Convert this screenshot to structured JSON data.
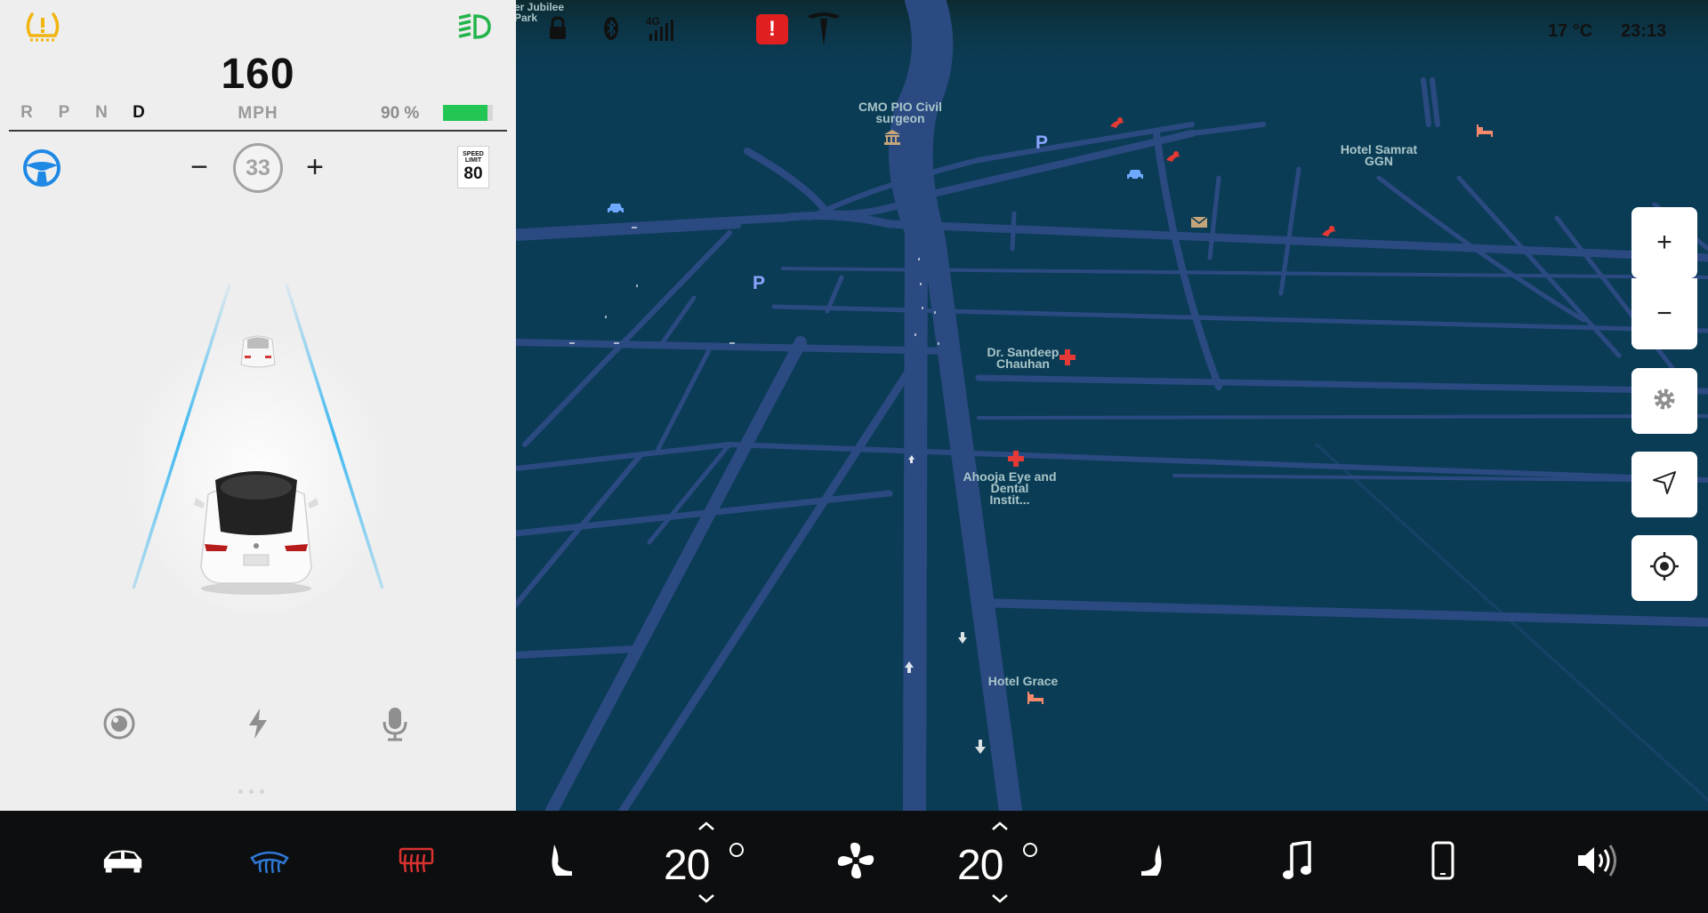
{
  "cluster": {
    "speed": "160",
    "units": "MPH",
    "gears": [
      {
        "label": "R",
        "active": false
      },
      {
        "label": "P",
        "active": false
      },
      {
        "label": "N",
        "active": false
      },
      {
        "label": "D",
        "active": true
      }
    ],
    "battery_label": "90 %",
    "battery_level": 0.9,
    "cruise": {
      "minus": "−",
      "speed": "33",
      "plus": "+"
    },
    "speed_limit": {
      "label_line1": "SPEED",
      "label_line2": "LIMIT",
      "value": "80"
    },
    "icons": {
      "tpms": "tire-pressure-warning-icon",
      "headlights": "headlights-icon",
      "autopilot": "steering-wheel-icon",
      "lead_car": "lead-car-icon",
      "ego_car": "ego-car-icon",
      "shortcut_1": "camera-icon",
      "shortcut_2": "charging-bolt-icon",
      "shortcut_3": "microphone-icon"
    },
    "colors": {
      "tpms": "#f2b40f",
      "headlights": "#22b44b",
      "autopilot": "#1e88e5",
      "battery": "#23c653",
      "lane_lines": "#3eb8f0"
    }
  },
  "map": {
    "status": {
      "temperature": "17 °C",
      "time": "23:13",
      "network": "4G",
      "icons": [
        "lock-icon",
        "bluetooth-icon",
        "signal-strength-icon",
        "alert-icon",
        "tesla-logo-icon"
      ],
      "alert_glyph": "!"
    },
    "labels": {
      "jubilee": "er Jubilee\nPark",
      "cmo": "CMO PIO Civil\nsurgeon",
      "hotel_samrat": "Hotel Samrat\nGGN",
      "dr_sandeep": "Dr. Sandeep\nChauhan",
      "ahooja": "Ahooja Eye and\nDental\nInstit...",
      "hotel_grace": "Hotel Grace",
      "parking": "P"
    },
    "controls": {
      "zoom_in": "+",
      "zoom_out": "−",
      "settings": "gear-icon",
      "navigate": "navigation-arrow-icon",
      "recenter": "recenter-icon"
    },
    "colors": {
      "background": "#0b3c55",
      "roads": "#2b4a82",
      "poi": "#a9c6c9",
      "hospital": "#e53935",
      "restaurant": "#e53935",
      "hotel": "#f48a6b",
      "parking": "#8aa4ff"
    }
  },
  "dock": {
    "icons": [
      "car-icon",
      "front-defrost-icon",
      "rear-defrost-icon",
      "seat-heater-left-icon",
      "fan-icon",
      "seat-heater-right-icon",
      "music-icon",
      "phone-icon",
      "volume-icon"
    ],
    "driver_temp": "20",
    "passenger_temp": "20",
    "colors": {
      "front_defrost": "#2f78d6",
      "rear_defrost": "#d93232"
    }
  }
}
